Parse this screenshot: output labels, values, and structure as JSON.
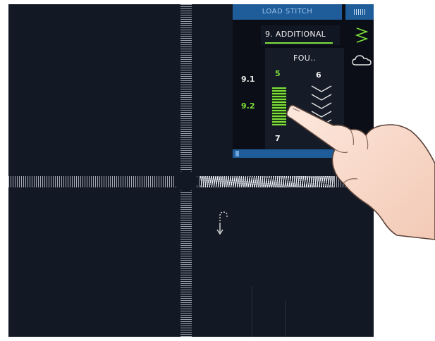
{
  "panel": {
    "load_stitch_label": "LOAD STITCH",
    "category_label": "9. ADDITIONAL",
    "sub_items": [
      {
        "label": "9.1",
        "selected": false
      },
      {
        "label": "9.2",
        "selected": true
      }
    ],
    "grid": {
      "title": "FOU..",
      "numbers": [
        "5",
        "6",
        "7"
      ],
      "selected_number": "5"
    }
  },
  "colors": {
    "screen_bg": "#121824",
    "panel_bg": "#0b0e16",
    "accent_green": "#7fe03a",
    "bar_blue": "#1f5d9a"
  },
  "icons": {
    "top_right": "stitch-density-icon",
    "zigzag": "zigzag-stitch-icon",
    "cloud": "cloud-icon",
    "turn": "u-turn-icon"
  }
}
